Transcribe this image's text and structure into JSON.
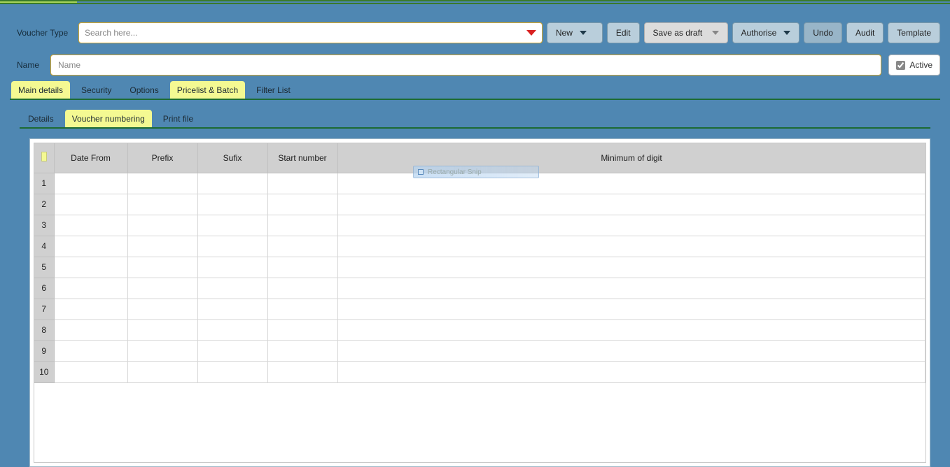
{
  "toolbar": {
    "voucher_type_label": "Voucher Type",
    "search_placeholder": "Search here...",
    "new_label": "New",
    "edit_label": "Edit",
    "save_draft_label": "Save as draft",
    "authorise_label": "Authorise",
    "undo_label": "Undo",
    "audit_label": "Audit",
    "template_label": "Template"
  },
  "name_row": {
    "label": "Name",
    "placeholder": "Name",
    "active_label": "Active",
    "active_checked": true
  },
  "tabs_main": [
    {
      "label": "Main details",
      "hl": true
    },
    {
      "label": "Security",
      "hl": false
    },
    {
      "label": "Options",
      "hl": false
    },
    {
      "label": "Pricelist & Batch",
      "hl": true
    },
    {
      "label": "Filter List",
      "hl": false
    }
  ],
  "tabs_sub": [
    {
      "label": "Details",
      "hl": false
    },
    {
      "label": "Voucher numbering",
      "hl": true
    },
    {
      "label": "Print file",
      "hl": false
    }
  ],
  "grid": {
    "columns": [
      "",
      "Date From",
      "Prefix",
      "Sufix",
      "Start number",
      "Minimum of digit"
    ],
    "rows": [
      {
        "n": "1",
        "date": "",
        "prefix": "",
        "sufix": "",
        "start": "",
        "min": ""
      },
      {
        "n": "2",
        "date": "",
        "prefix": "",
        "sufix": "",
        "start": "",
        "min": ""
      },
      {
        "n": "3",
        "date": "",
        "prefix": "",
        "sufix": "",
        "start": "",
        "min": ""
      },
      {
        "n": "4",
        "date": "",
        "prefix": "",
        "sufix": "",
        "start": "",
        "min": ""
      },
      {
        "n": "5",
        "date": "",
        "prefix": "",
        "sufix": "",
        "start": "",
        "min": ""
      },
      {
        "n": "6",
        "date": "",
        "prefix": "",
        "sufix": "",
        "start": "",
        "min": ""
      },
      {
        "n": "7",
        "date": "",
        "prefix": "",
        "sufix": "",
        "start": "",
        "min": ""
      },
      {
        "n": "8",
        "date": "",
        "prefix": "",
        "sufix": "",
        "start": "",
        "min": ""
      },
      {
        "n": "9",
        "date": "",
        "prefix": "",
        "sufix": "",
        "start": "",
        "min": ""
      },
      {
        "n": "10",
        "date": "",
        "prefix": "",
        "sufix": "",
        "start": "",
        "min": ""
      }
    ]
  },
  "overlay": {
    "text": "Rectangular Snip"
  }
}
